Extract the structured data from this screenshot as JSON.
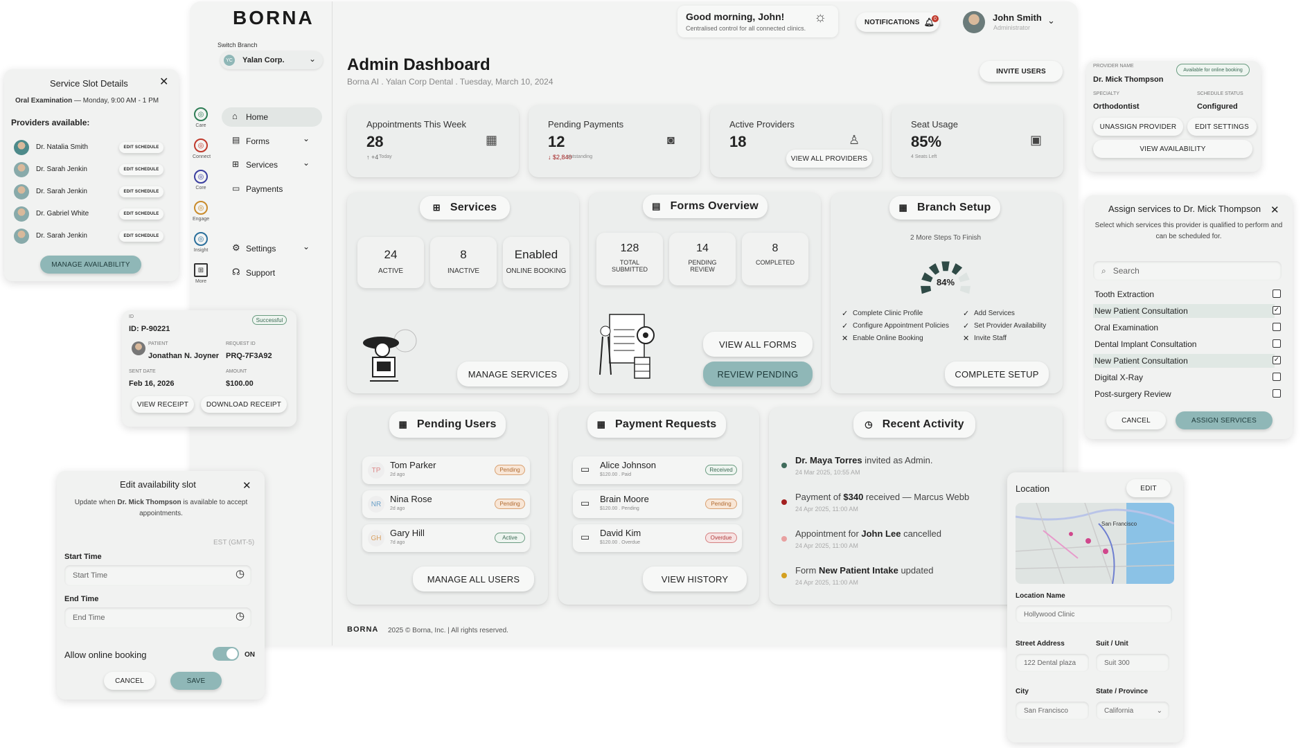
{
  "brand": "BORNA",
  "sidebar": {
    "switch_label": "Switch Branch",
    "branch_initials": "YC",
    "branch_name": "Yalan Corp.",
    "rail": [
      {
        "label": "Care",
        "color": "#2e7d55"
      },
      {
        "label": "Connect",
        "color": "#c0392b"
      },
      {
        "label": "Core",
        "color": "#3b3fa0"
      },
      {
        "label": "Engage",
        "color": "#c98b2a"
      },
      {
        "label": "Insight",
        "color": "#2a6f9b"
      },
      {
        "label": "More",
        "color": "#333"
      }
    ],
    "nav": [
      "Home",
      "Forms",
      "Services",
      "Payments"
    ],
    "nav2": [
      "Settings",
      "Support"
    ]
  },
  "header": {
    "greeting": "Good morning, John!",
    "greeting_sub": "Centralised control for all connected clinics.",
    "notifications": "NOTIFICATIONS",
    "notif_count": "0",
    "user_name": "John Smith",
    "user_role": "Administrator"
  },
  "page": {
    "title": "Admin Dashboard",
    "breadcrumb": "Borna AI . Yalan Corp Dental . Tuesday, March 10, 2024",
    "invite": "INVITE USERS"
  },
  "stats": [
    {
      "label": "Appointments This Week",
      "value": "28",
      "delta": "↑ +4",
      "delta_note": "Today",
      "icon": "calendar-icon"
    },
    {
      "label": "Pending Payments",
      "value": "12",
      "delta": "↓ $2,840",
      "delta_note": "outstanding",
      "icon": "cash-icon"
    },
    {
      "label": "Active Providers",
      "value": "18",
      "button": "VIEW ALL PROVIDERS",
      "icon": "provider-icon"
    },
    {
      "label": "Seat Usage",
      "value": "85%",
      "delta_note": "4 Seats Left",
      "icon": "seat-icon"
    }
  ],
  "services": {
    "title": "Services",
    "stats": [
      {
        "v": "24",
        "l": "ACTIVE"
      },
      {
        "v": "8",
        "l": "INACTIVE"
      },
      {
        "v": "Enabled",
        "l": "ONLINE BOOKING"
      }
    ],
    "button": "MANAGE SERVICES"
  },
  "forms": {
    "title": "Forms Overview",
    "stats": [
      {
        "v": "128",
        "l": "TOTAL SUBMITTED"
      },
      {
        "v": "14",
        "l": "PENDING REVIEW"
      },
      {
        "v": "8",
        "l": "COMPLETED"
      }
    ],
    "view_all": "VIEW ALL FORMS",
    "review": "REVIEW PENDING"
  },
  "branch": {
    "title": "Branch Setup",
    "steps_note": "2 More Steps To Finish",
    "progress": "84%",
    "progress_value": 0.84,
    "checks": [
      {
        "t": "Complete Clinic Profile",
        "done": true
      },
      {
        "t": "Add Services",
        "done": true
      },
      {
        "t": "Configure Appointment Policies",
        "done": true
      },
      {
        "t": "Set Provider Availability",
        "done": true
      },
      {
        "t": "Enable Online Booking",
        "done": false
      },
      {
        "t": "Invite Staff",
        "done": false
      }
    ],
    "button": "COMPLETE SETUP"
  },
  "pending_users": {
    "title": "Pending Users",
    "rows": [
      {
        "initials": "TP",
        "name": "Tom Parker",
        "sub": "2d ago",
        "status": "Pending",
        "kind": "pending"
      },
      {
        "initials": "NR",
        "name": "Nina Rose",
        "sub": "2d ago",
        "status": "Pending",
        "kind": "pending"
      },
      {
        "initials": "GH",
        "name": "Gary Hill",
        "sub": "7d ago",
        "status": "Active",
        "kind": "active"
      }
    ],
    "button": "MANAGE ALL USERS"
  },
  "payments": {
    "title": "Payment Requests",
    "rows": [
      {
        "name": "Alice Johnson",
        "sub": "$120.00 . Paid",
        "status": "Received",
        "kind": "active"
      },
      {
        "name": "Brain Moore",
        "sub": "$120.00 . Pending",
        "status": "Pending",
        "kind": "pending"
      },
      {
        "name": "David Kim",
        "sub": "$120.00 . Overdue",
        "status": "Overdue",
        "kind": "overdue"
      }
    ],
    "button": "VIEW HISTORY"
  },
  "activity": {
    "title": "Recent Activity",
    "rows": [
      {
        "color": "#3f6b5b",
        "pre": "",
        "bold": "Dr. Maya Torres",
        "post": " invited as Admin.",
        "time": "24 Mar 2025, 10:55 AM"
      },
      {
        "color": "#a32020",
        "pre": "Payment of ",
        "bold": "$340",
        "post": " received — Marcus Webb",
        "time": "24 Apr 2025, 11:00 AM"
      },
      {
        "color": "#e8a0a0",
        "pre": "Appointment for ",
        "bold": "John Lee",
        "post": " cancelled",
        "time": "24 Apr 2025, 11:00 AM"
      },
      {
        "color": "#d4a020",
        "pre": "Form ",
        "bold": "New Patient Intake",
        "post": " updated",
        "time": "24 Apr 2025, 11:00 AM"
      }
    ]
  },
  "footer": {
    "logo": "BORNA",
    "text": "2025 © Borna, Inc. | All rights reserved."
  },
  "slot": {
    "title": "Service Slot Details",
    "sub_bold": "Oral Examination",
    "sub": " — Monday, 9:00 AM - 1 PM",
    "providers_label": "Providers available:",
    "providers": [
      "Dr. Natalia Smith",
      "Dr. Sarah Jenkin",
      "Dr. Sarah Jenkin",
      "Dr. Gabriel  White",
      "Dr. Sarah Jenkin"
    ],
    "edit": "EDIT SCHEDULE",
    "button": "MANAGE AVAILABILITY"
  },
  "receipt": {
    "id_label": "ID",
    "id": "ID: P-90221",
    "status": "Successful",
    "patient_label": "PATIENT",
    "patient": "Jonathan N. Joyner",
    "req_label": "REQUEST ID",
    "req": "PRQ-7F3A92",
    "sent_label": "SENT DATE",
    "sent": "Feb 16, 2026",
    "amount_label": "AMOUNT",
    "amount": "$100.00",
    "view": "VIEW RECEIPT",
    "download": "DOWNLOAD RECEIPT"
  },
  "edit_slot": {
    "title": "Edit availability slot",
    "desc_pre": "Update when ",
    "desc_bold": "Dr. Mick Thompson",
    "desc_post": " is available to accept appointments.",
    "tz": "EST (GMT-5)",
    "start_label": "Start Time",
    "start_ph": "Start Time",
    "end_label": "End Time",
    "end_ph": "End Time",
    "online": "Allow online booking",
    "toggle": "ON",
    "cancel": "CANCEL",
    "save": "SAVE"
  },
  "provider": {
    "name_label": "PROVIDER NAME",
    "name": "Dr. Mick Thompson",
    "badge": "Available for online booking",
    "spec_label": "SPECIALTY",
    "spec": "Orthodontist",
    "sched_label": "SCHEDULE STATUS",
    "sched": "Configured",
    "unassign": "UNASSIGN PROVIDER",
    "edit": "EDIT SETTINGS",
    "view": "VIEW AVAILABILITY"
  },
  "assign": {
    "title": "Assign services to Dr. Mick Thompson",
    "desc": "Select which services this provider is qualified to perform and can be scheduled for.",
    "search_ph": "Search",
    "items": [
      {
        "t": "Tooth Extraction",
        "c": false
      },
      {
        "t": "New Patient Consultation",
        "c": true
      },
      {
        "t": "Oral Examination",
        "c": false
      },
      {
        "t": "Dental Implant Consultation",
        "c": false
      },
      {
        "t": "New Patient Consultation",
        "c": true
      },
      {
        "t": "Digital X-Ray",
        "c": false
      },
      {
        "t": "Post-surgery Review",
        "c": false
      }
    ],
    "cancel": "CANCEL",
    "assign": "ASSIGN SERVICES"
  },
  "location": {
    "title": "Location",
    "edit": "EDIT",
    "map_label": "San Francisco",
    "name_label": "Location Name",
    "name": "Hollywood Clinic",
    "street_label": "Street Address",
    "street": "122 Dental plaza",
    "suit_label": "Suit / Unit",
    "suit": "Suit 300",
    "city_label": "City",
    "city": "San Francisco",
    "state_label": "State / Province",
    "state": "California"
  }
}
